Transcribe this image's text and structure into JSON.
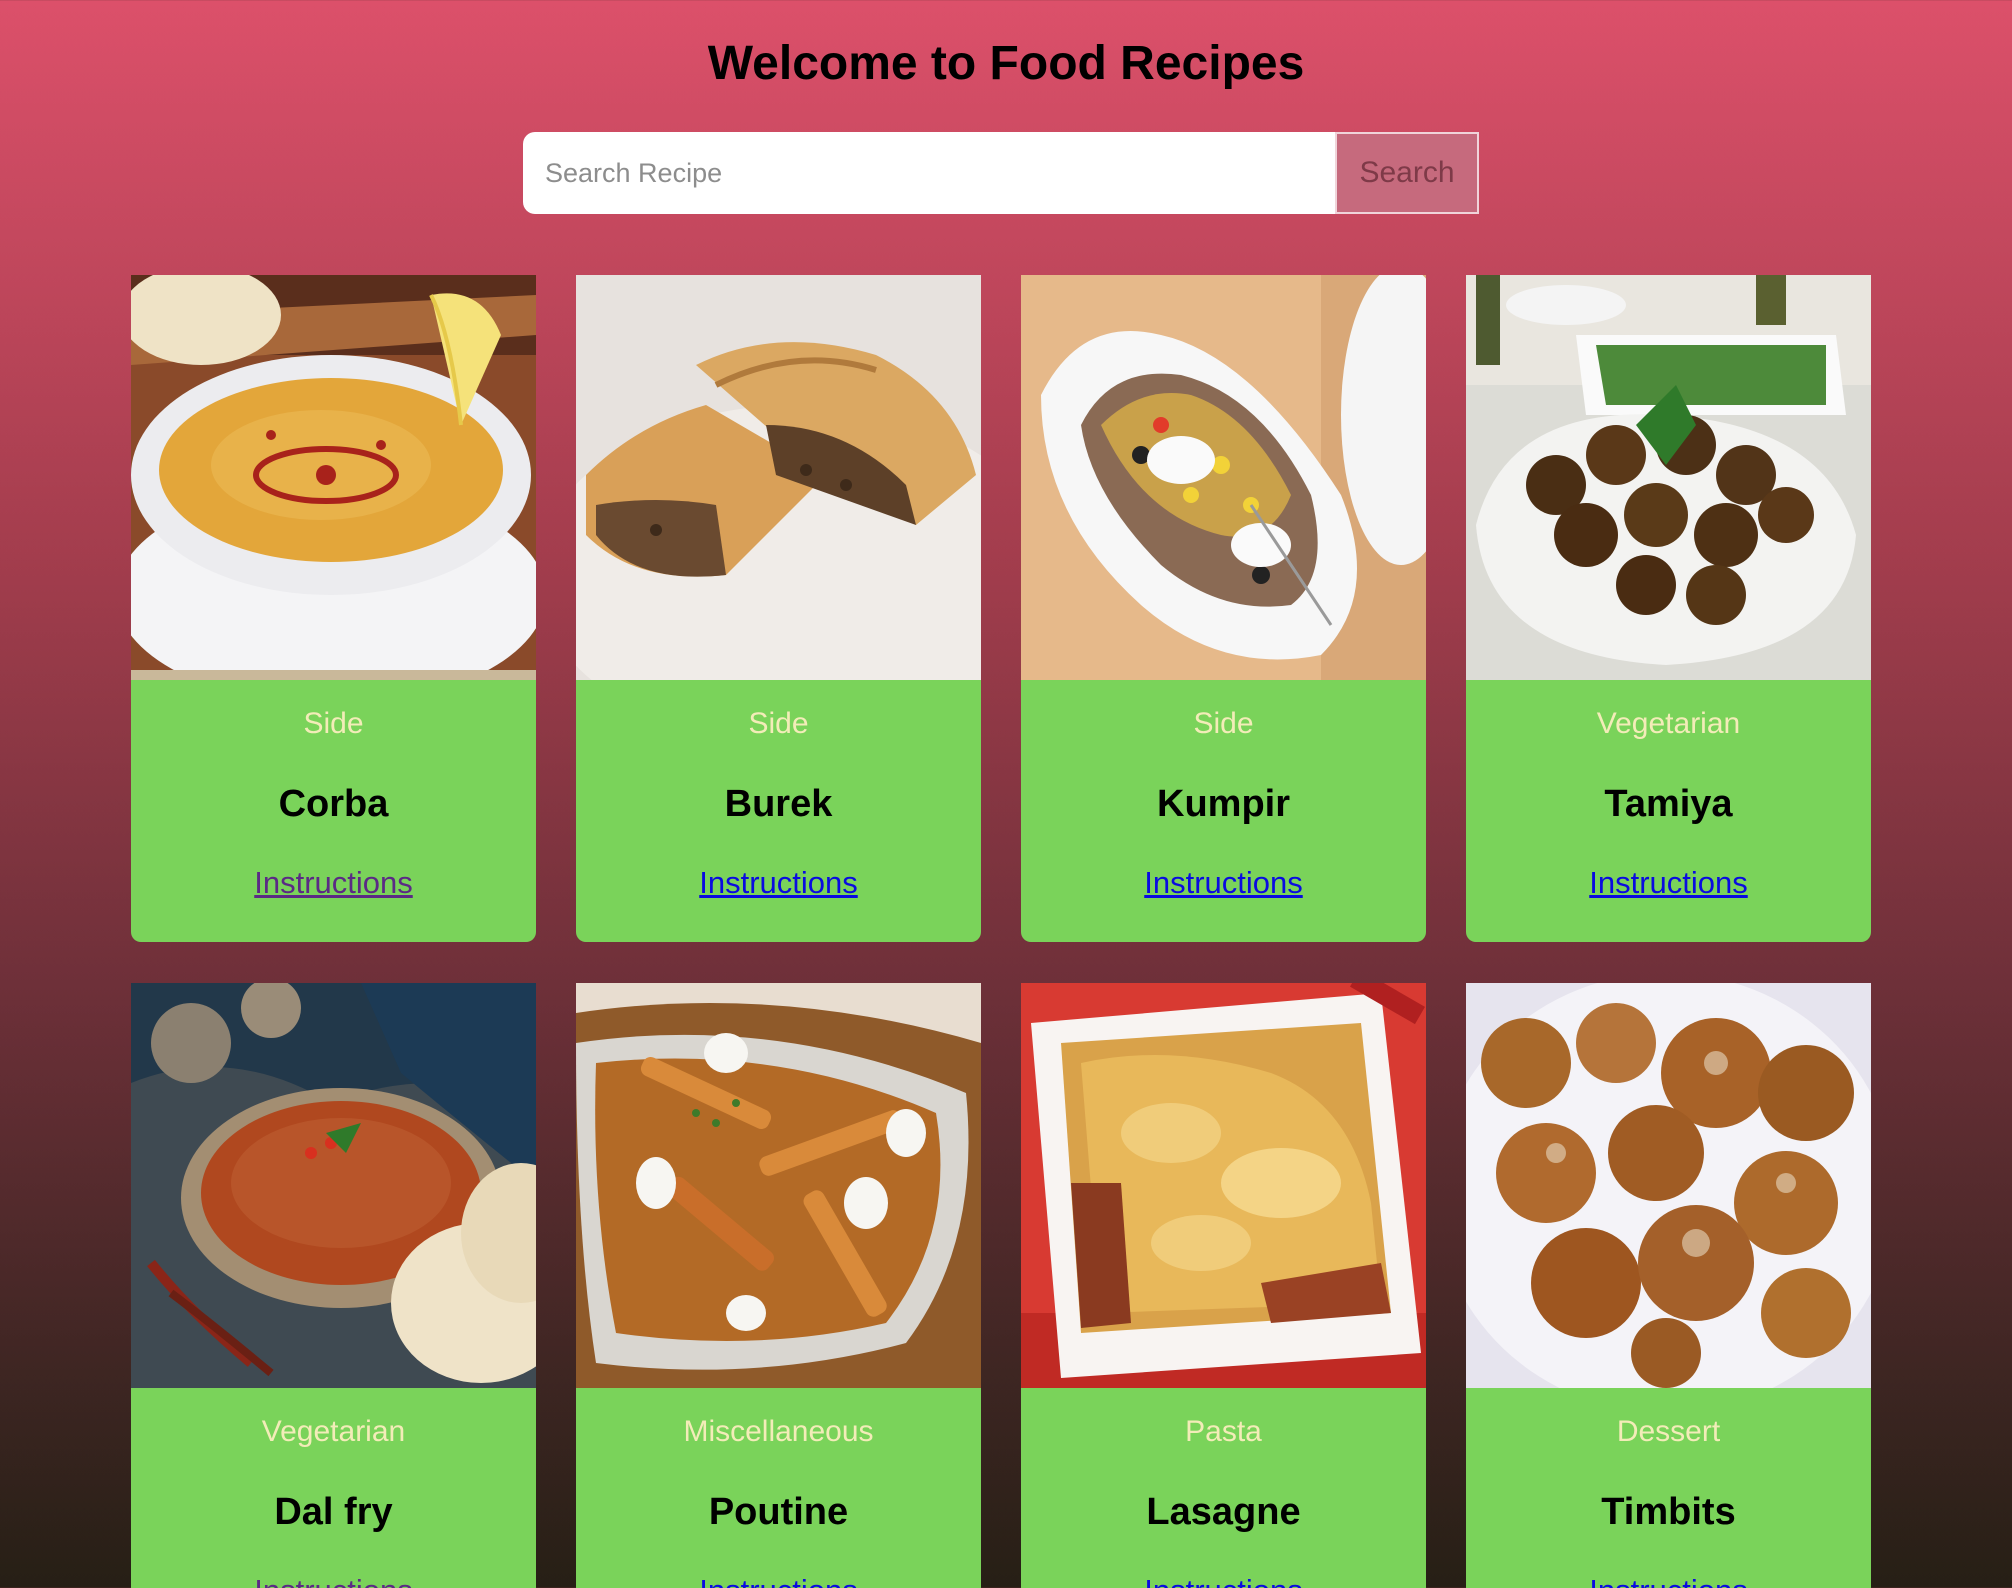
{
  "header": {
    "title": "Welcome to Food Recipes"
  },
  "search": {
    "placeholder": "Search Recipe",
    "value": "",
    "button_label": "Search"
  },
  "colors": {
    "card_background": "#7ad35a",
    "category_text": "#f3ecb8",
    "link": "#0a0be0",
    "link_visited": "#5b2a85",
    "search_button": "#c66a7d"
  },
  "recipes": [
    {
      "category": "Side",
      "name": "Corba",
      "link_label": "Instructions",
      "image": "lentil-soup-photo",
      "link_visited": true
    },
    {
      "category": "Side",
      "name": "Burek",
      "link_label": "Instructions",
      "image": "meat-pastry-photo",
      "link_visited": false
    },
    {
      "category": "Side",
      "name": "Kumpir",
      "link_label": "Instructions",
      "image": "stuffed-potato-photo",
      "link_visited": false
    },
    {
      "category": "Vegetarian",
      "name": "Tamiya",
      "link_label": "Instructions",
      "image": "falafel-photo",
      "link_visited": false
    },
    {
      "category": "Vegetarian",
      "name": "Dal fry",
      "link_label": "Instructions",
      "image": "dal-curry-photo",
      "link_visited": true
    },
    {
      "category": "Miscellaneous",
      "name": "Poutine",
      "link_label": "Instructions",
      "image": "fries-gravy-photo",
      "link_visited": false
    },
    {
      "category": "Pasta",
      "name": "Lasagne",
      "link_label": "Instructions",
      "image": "lasagne-dish-photo",
      "link_visited": false
    },
    {
      "category": "Dessert",
      "name": "Timbits",
      "link_label": "Instructions",
      "image": "sugared-doughnut-photo",
      "link_visited": false
    }
  ]
}
